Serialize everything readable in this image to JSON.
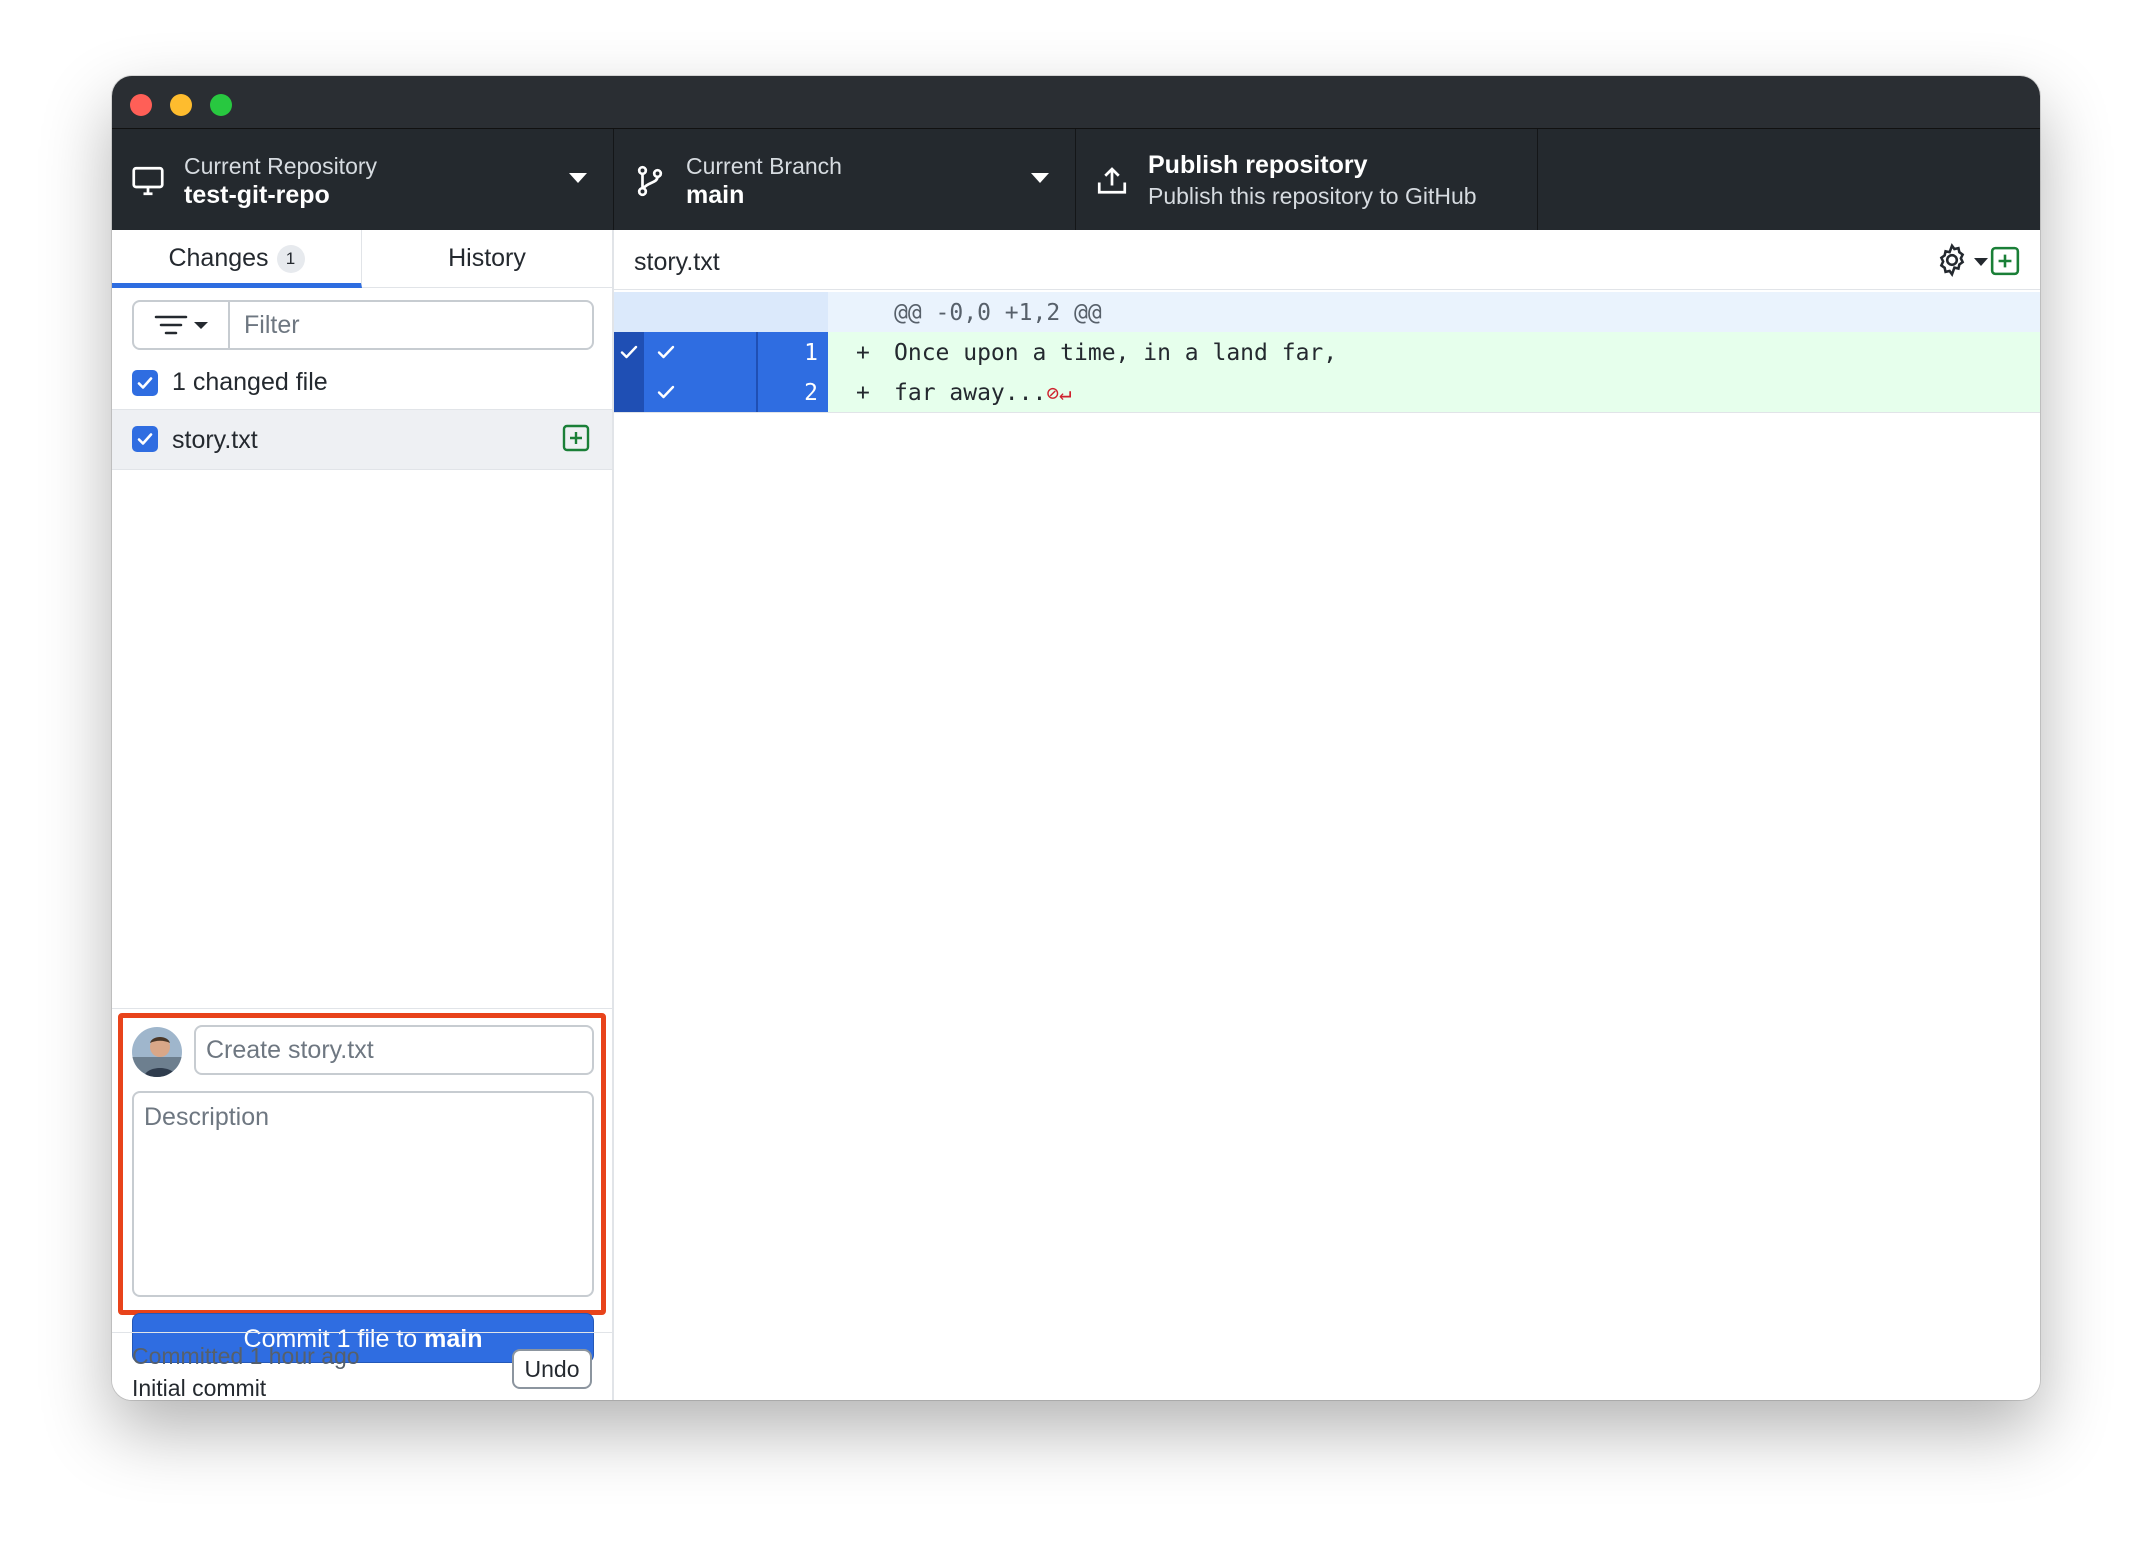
{
  "toolbar": {
    "repo": {
      "label": "Current Repository",
      "name": "test-git-repo"
    },
    "branch": {
      "label": "Current Branch",
      "name": "main"
    },
    "publish": {
      "title": "Publish repository",
      "subtitle": "Publish this repository to GitHub"
    }
  },
  "sidebar": {
    "tabs": [
      {
        "label": "Changes",
        "count": "1"
      },
      {
        "label": "History"
      }
    ],
    "filter_placeholder": "Filter",
    "changed_files_label": "1 changed file",
    "files": [
      {
        "name": "story.txt",
        "checked": true,
        "status": "added"
      }
    ],
    "commit": {
      "summary_placeholder": "Create story.txt",
      "description_placeholder": "Description",
      "button_prefix": "Commit 1 file to ",
      "button_branch": "main"
    },
    "last_commit": {
      "time": "Committed 1 hour ago",
      "message": "Initial commit",
      "undo_label": "Undo"
    }
  },
  "diff": {
    "file_name": "story.txt",
    "hunk_header": "@@ -0,0 +1,2 @@",
    "lines": [
      {
        "number": "1",
        "prefix": "+",
        "text": "Once upon a time, in a land far,"
      },
      {
        "number": "2",
        "prefix": "+",
        "text": "far away...",
        "no_newline_marker": "⊘↵"
      }
    ]
  },
  "colors": {
    "accent": "#2f6de1",
    "toolbar": "#24292e",
    "added_line": "#e6ffec",
    "highlight": "#e8431b",
    "added_icon": "#1a7f37"
  }
}
